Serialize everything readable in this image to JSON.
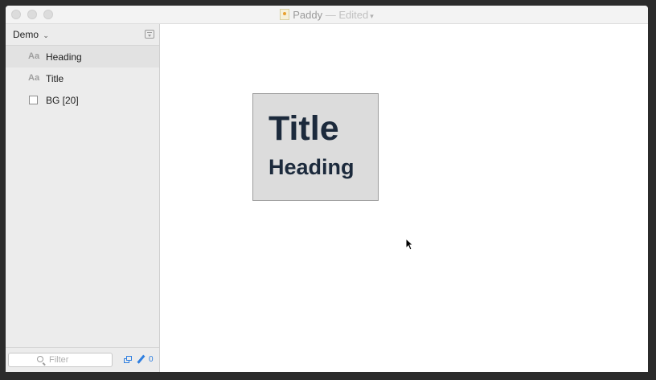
{
  "window": {
    "app_name": "Paddy",
    "status": "— Edited",
    "accent_color": "#2f7fe0"
  },
  "sidebar": {
    "document_selector": "Demo",
    "items": [
      {
        "icon": "text-style-icon",
        "icon_glyph": "Aa",
        "label": "Heading",
        "selected": true
      },
      {
        "icon": "text-style-icon",
        "icon_glyph": "Aa",
        "label": "Title",
        "selected": false
      },
      {
        "icon": "color-swatch-icon",
        "label": "BG [20]",
        "selected": false
      }
    ],
    "filter": {
      "placeholder": "Filter",
      "value": ""
    },
    "footer": {
      "count": "0"
    }
  },
  "canvas": {
    "artboard": {
      "title": "Title",
      "heading": "Heading",
      "background_color": "#dcdcdc",
      "text_color": "#1c2a3c"
    }
  }
}
